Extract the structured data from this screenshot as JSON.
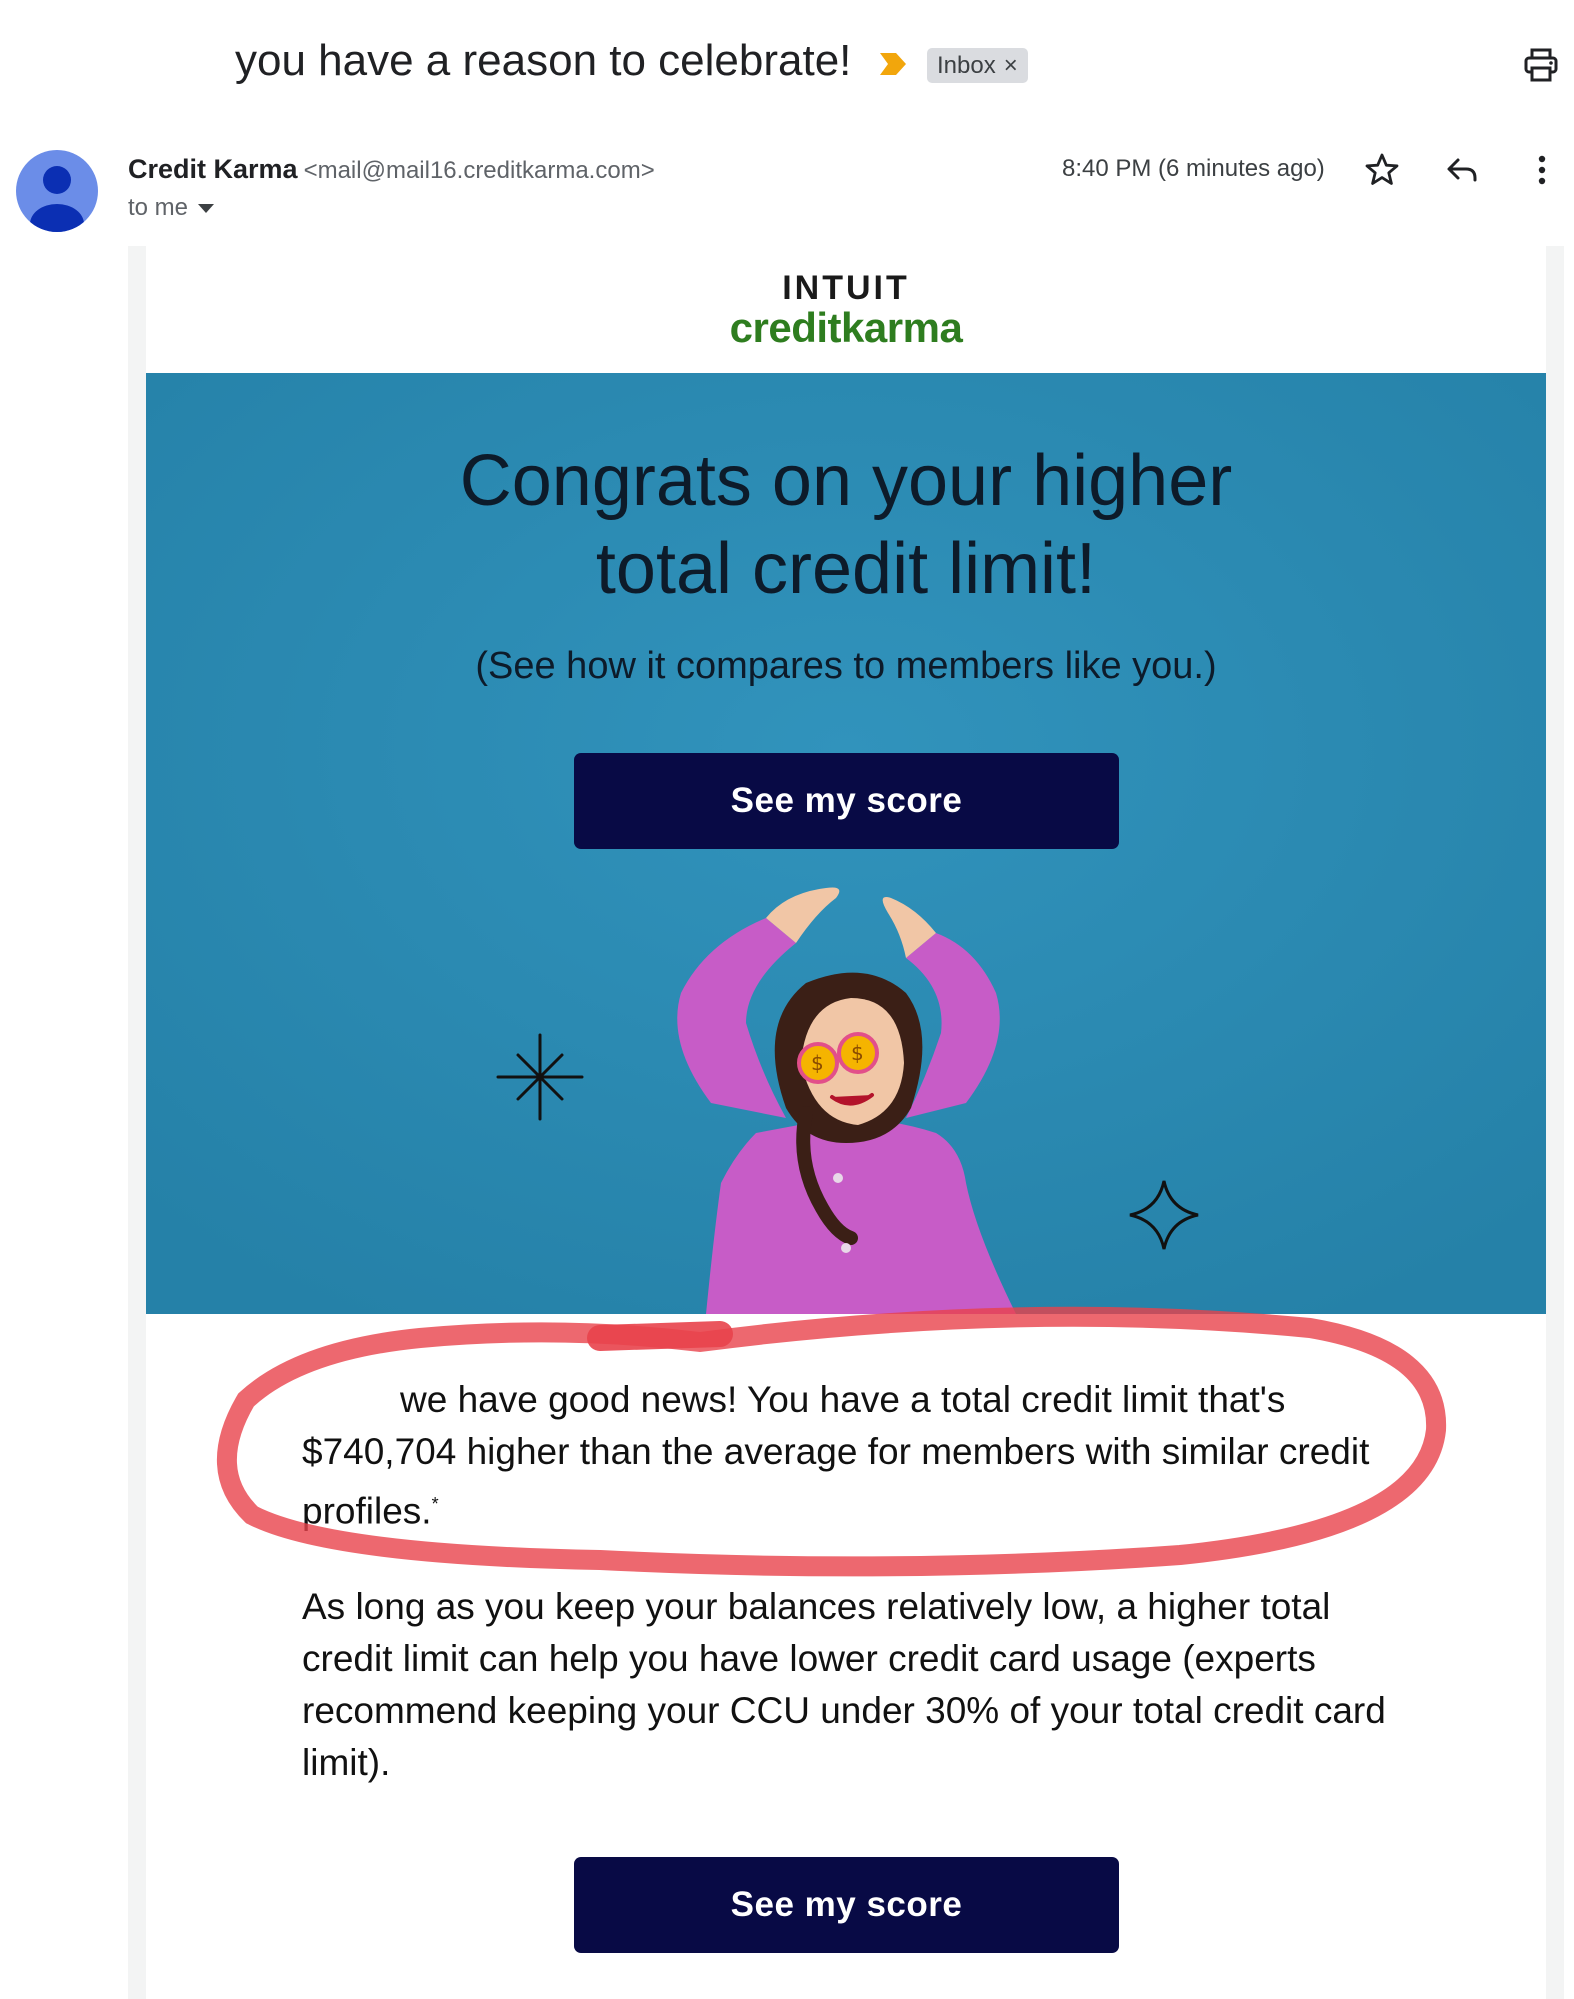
{
  "header": {
    "subject": "you have a reason to celebrate!",
    "label_chip": "Inbox",
    "label_chip_close": "×"
  },
  "sender": {
    "name": "Credit Karma",
    "email": "<mail@mail16.creditkarma.com>",
    "recipient": "to me",
    "timestamp": "8:40 PM (6 minutes ago)"
  },
  "email": {
    "logo_top": "INTUIT",
    "logo_bottom": "creditkarma",
    "hero_title_line1": "Congrats on your higher",
    "hero_title_line2": "total credit limit!",
    "hero_subtitle": "(See how it compares to members like you.)",
    "cta_label": "See my score",
    "paragraph1": "we have good news! You have a total credit limit that's $740,704 higher than the average for members with similar credit profiles.",
    "paragraph1_footnote": "*",
    "paragraph2": "As long as you keep your balances relatively low, a higher total credit limit can help you have lower credit card usage (experts recommend keeping your CCU under 30% of your total credit card limit).",
    "cta2_label": "See my score"
  },
  "colors": {
    "hero_bg": "#2c8bb3",
    "cta_bg": "#080a45",
    "logo_green": "#2e7d1f",
    "annotation_red": "#e8424b",
    "importance_marker": "#f2a60c"
  },
  "icons": [
    "importance-marker-icon",
    "print-icon",
    "avatar-icon",
    "star-icon",
    "reply-icon",
    "more-vert-icon",
    "sparkle-icon",
    "four-point-star-icon"
  ]
}
